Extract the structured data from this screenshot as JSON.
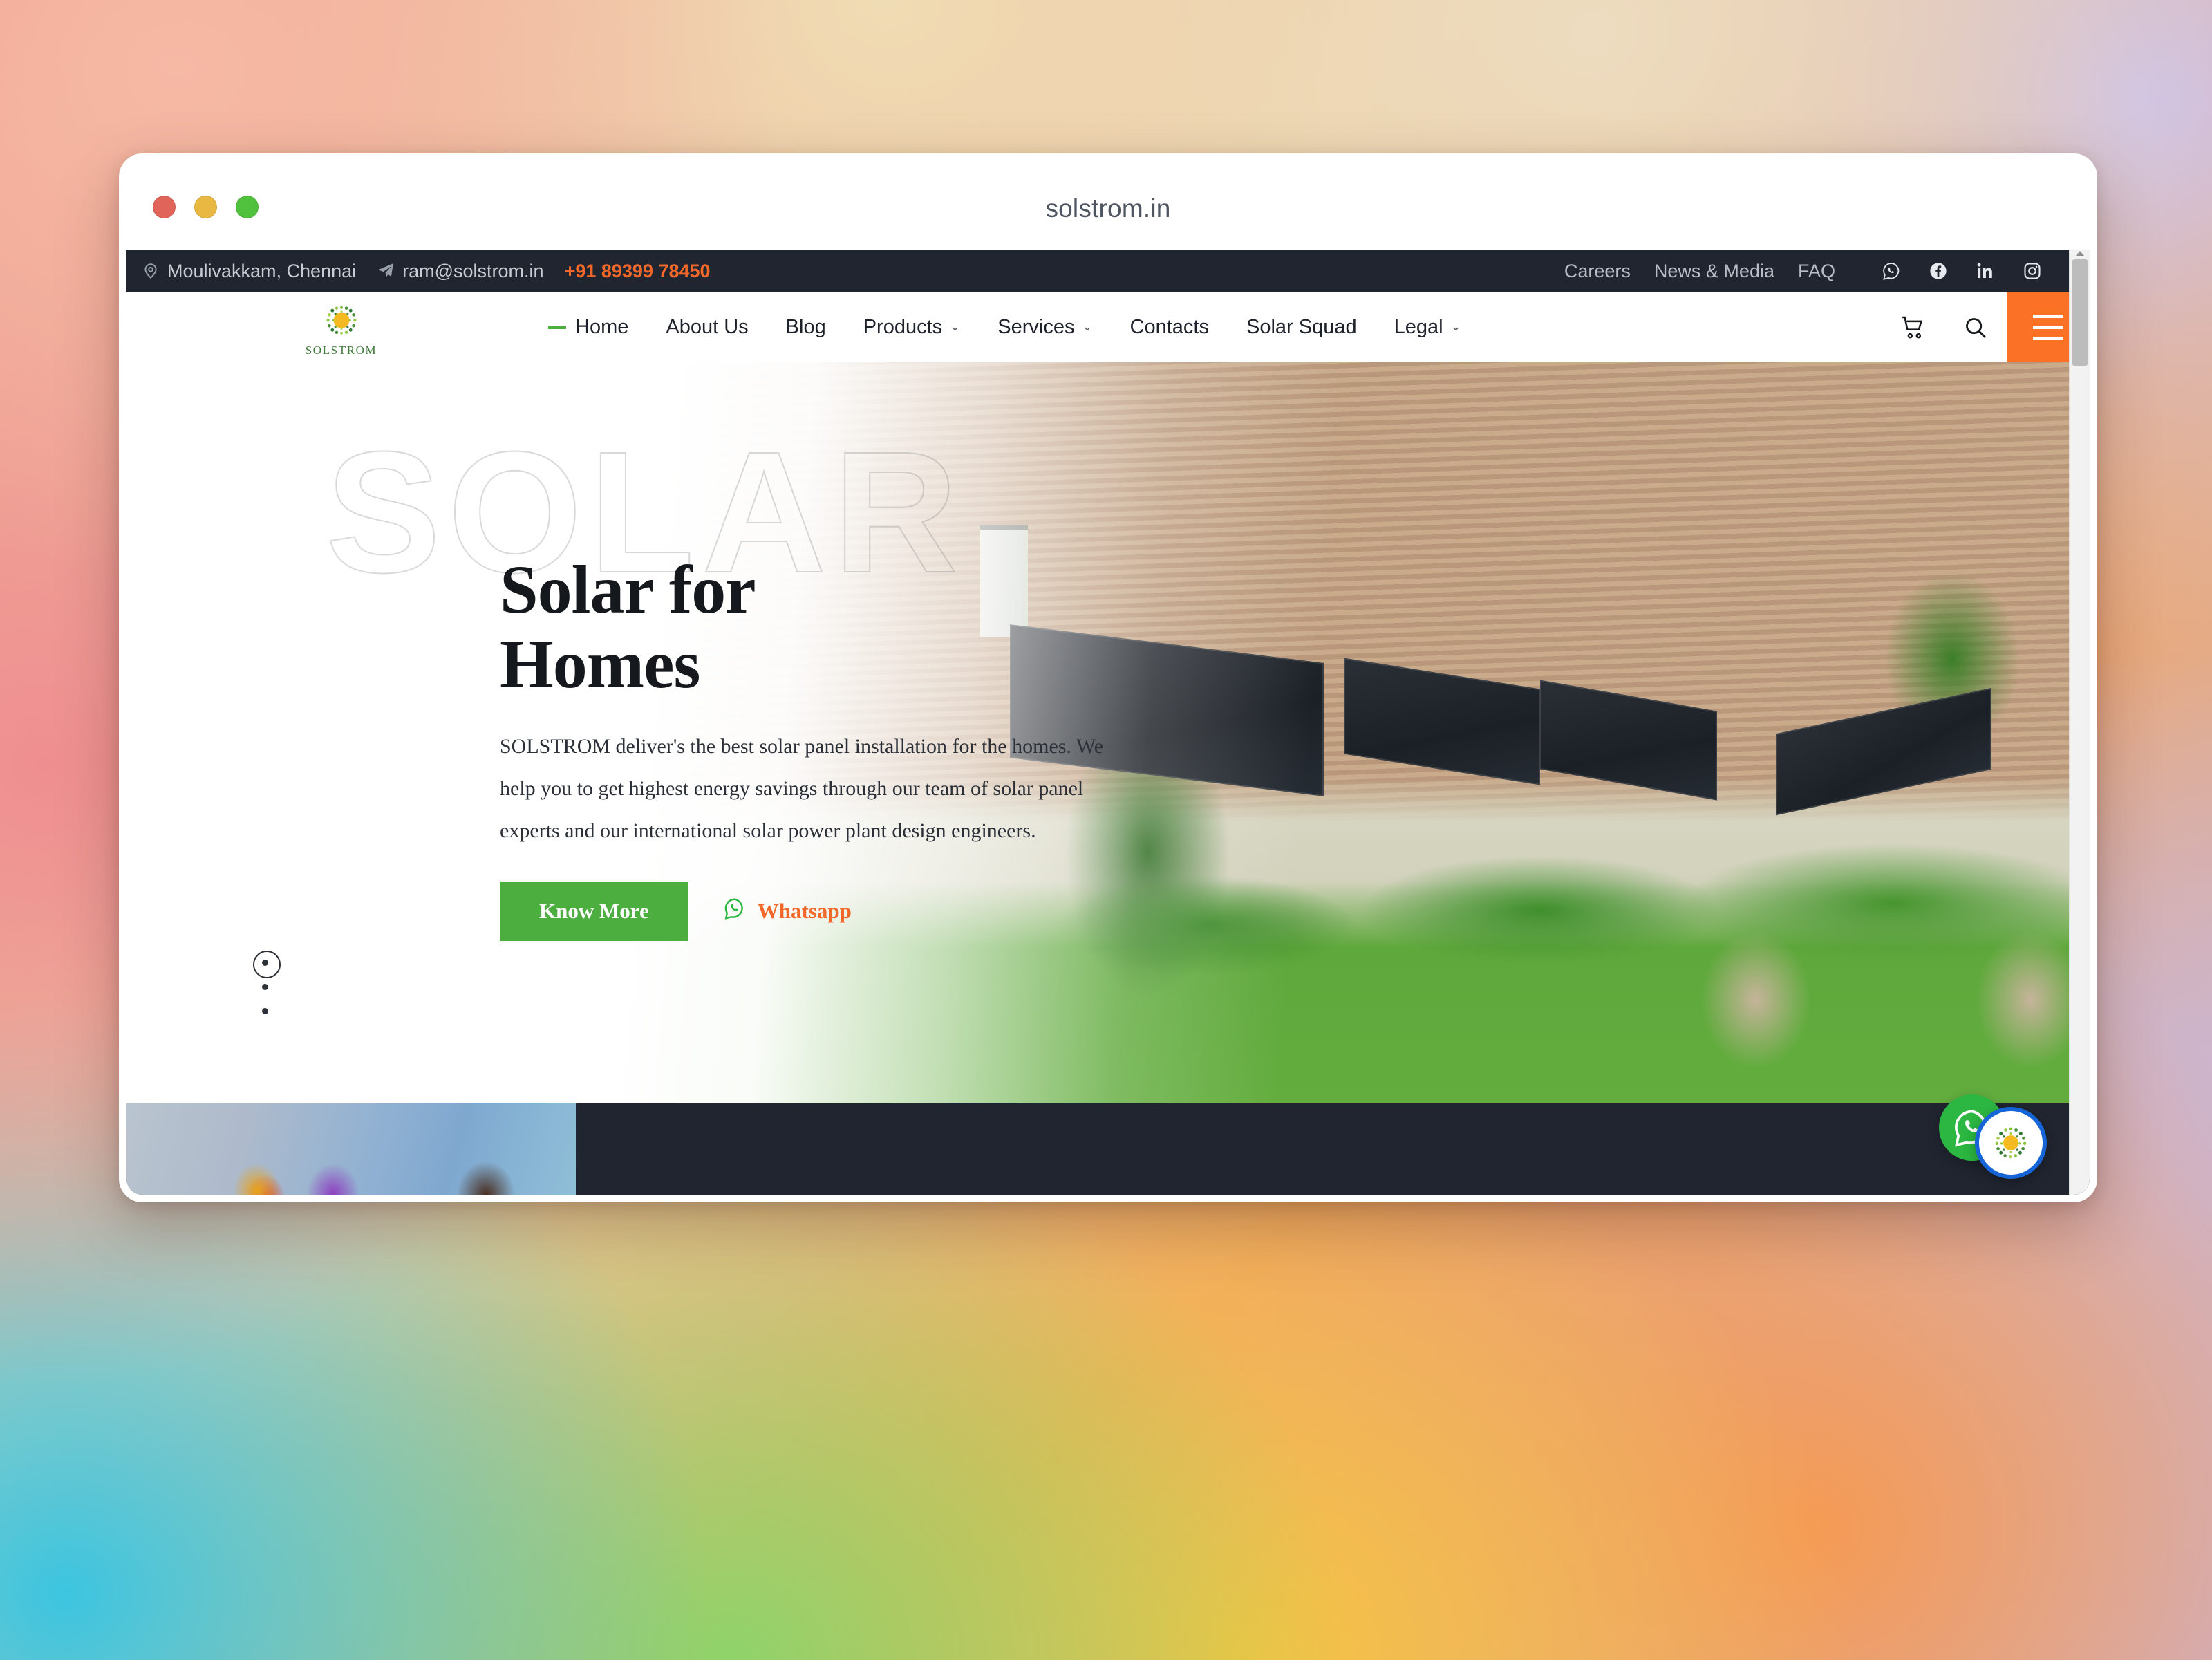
{
  "browser": {
    "tab_title": "solstrom.in",
    "traffic_lights": [
      "close",
      "minimize",
      "zoom"
    ]
  },
  "topbar": {
    "location": "Moulivakkam, Chennai",
    "email": "ram@solstrom.in",
    "phone": "+91 89399 78450",
    "links": [
      "Careers",
      "News & Media",
      "FAQ"
    ],
    "socials": [
      "whatsapp-icon",
      "facebook-icon",
      "linkedin-icon",
      "instagram-icon"
    ],
    "bg_color": "#202530",
    "phone_color": "#f1682a"
  },
  "navbar": {
    "logo_text": "SOLSTROM",
    "menu": [
      {
        "label": "Home",
        "active": true,
        "caret": false
      },
      {
        "label": "About Us",
        "active": false,
        "caret": false
      },
      {
        "label": "Blog",
        "active": false,
        "caret": false
      },
      {
        "label": "Products",
        "active": false,
        "caret": true
      },
      {
        "label": "Services",
        "active": false,
        "caret": true
      },
      {
        "label": "Contacts",
        "active": false,
        "caret": false
      },
      {
        "label": "Solar Squad",
        "active": false,
        "caret": false
      },
      {
        "label": "Legal",
        "active": false,
        "caret": true
      }
    ],
    "caret_glyph": "⌄",
    "cart_icon": "cart-icon",
    "search_icon": "search-icon",
    "menu_icon": "hamburger-icon",
    "accent_color": "#fb7227",
    "active_dash_color": "#4cae3f"
  },
  "hero": {
    "watermark": "SOLAR",
    "title_line1": "Solar for",
    "title_line2": "Homes",
    "description": "SOLSTROM deliver's the best solar panel installation for the homes. We help you to get highest energy savings through our team of solar panel experts and our international solar power plant design engineers.",
    "primary_button": "Know More",
    "whatsapp_label": "Whatsapp",
    "primary_button_color": "#4cae3f",
    "whatsapp_text_color": "#f1682a",
    "slides": [
      {
        "index": 1,
        "active": true
      },
      {
        "index": 2,
        "active": false
      },
      {
        "index": 3,
        "active": false
      }
    ]
  },
  "floating": {
    "whatsapp_fab": "whatsapp-fab-icon",
    "chat_widget": "solstrom-chat-icon",
    "whatsapp_fab_color": "#2bb741",
    "chat_ring_color": "#1565d8"
  },
  "scrollbar": {
    "position": "top",
    "thumb_label": "vertical-scroll-thumb"
  }
}
